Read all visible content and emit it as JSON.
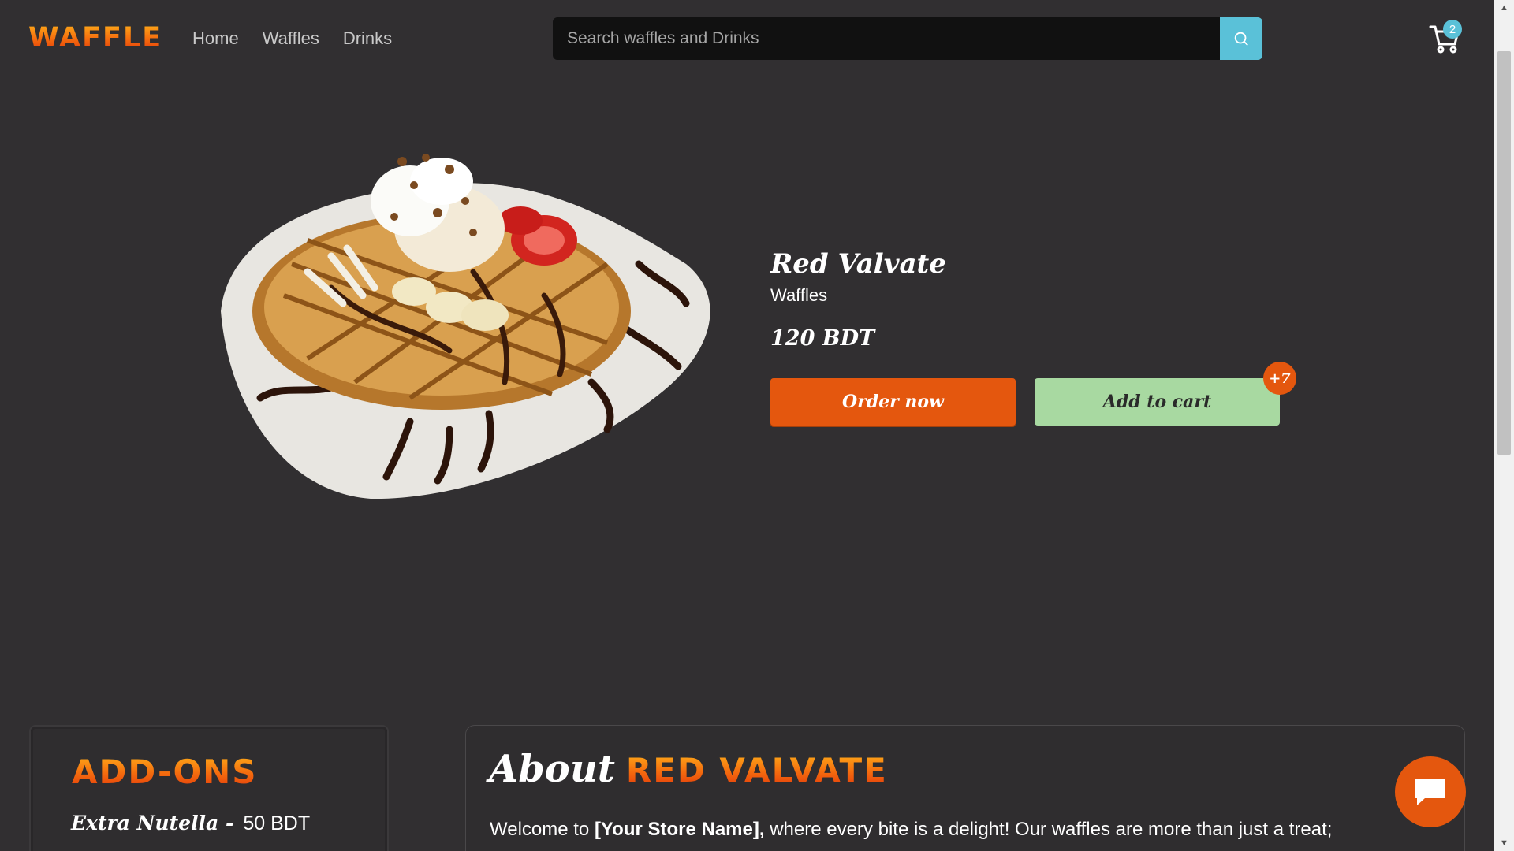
{
  "header": {
    "logo": "WAFFLE",
    "nav": [
      "Home",
      "Waffles",
      "Drinks"
    ],
    "search_placeholder": "Search waffles and Drinks",
    "cart_count": "2"
  },
  "product": {
    "name": "Red Valvate",
    "category": "Waffles",
    "price": "120 BDT",
    "order_label": "Order now",
    "add_cart_label": "Add to cart",
    "extra_badge": "+7"
  },
  "addons": {
    "title": "ADD-ONS",
    "items": [
      {
        "name": "Extra Nutella -",
        "price": "50 BDT"
      }
    ]
  },
  "about": {
    "heading_word": "About",
    "heading_product": "RED VALVATE",
    "intro_before": "Welcome to ",
    "store_name": "[Your Store Name],",
    "intro_after": " where every bite is a delight! Our waffles are more than just a treat;"
  },
  "colors": {
    "accent_orange": "#e4570e",
    "accent_teal": "#5ac1d8",
    "cart_green": "#a8d9a1",
    "background": "#312f31"
  },
  "icons": {
    "search": "search-icon",
    "cart": "cart-icon",
    "chat": "chat-bubble-icon"
  }
}
